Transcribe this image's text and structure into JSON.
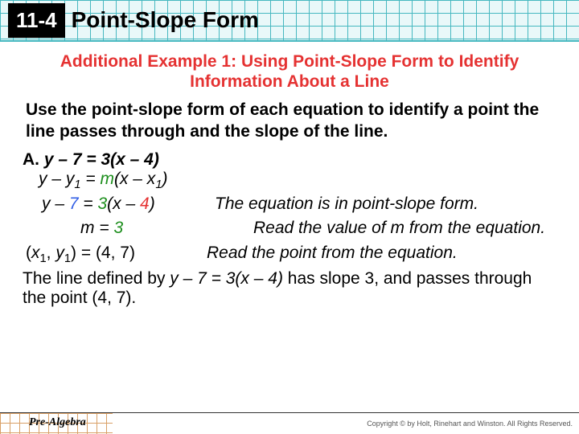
{
  "header": {
    "lesson_number": "11-4",
    "lesson_title": "Point-Slope Form"
  },
  "subhead": "Additional Example 1: Using Point-Slope Form to Identify Information About a Line",
  "prompt": "Use the point-slope form of each equation to identify a point the line passes through and the slope of the line.",
  "problem": {
    "label": "A.",
    "equation_plain": "y – 7 = 3(x – 4)"
  },
  "template": {
    "left": "y – y",
    "mid": " = ",
    "m": "m",
    "after_m": "(x – x",
    "close": ")"
  },
  "steps": [
    {
      "lhs_parts": {
        "prefix": "y – ",
        "y1": "7",
        "mid": " = ",
        "m": "3",
        "after_m": "(x – ",
        "x1": "4",
        "close": ")"
      },
      "expl": "The equation is in point-slope form."
    },
    {
      "lhs_m": {
        "prefix": "m = ",
        "m": "3"
      },
      "expl": "Read the value of m from the equation."
    },
    {
      "lhs_point": {
        "open": "(",
        "x1v": "x",
        "xsub": "1",
        "sep": ", ",
        "y1v": "y",
        "ysub": "1",
        "close": ") = (4, 7)"
      },
      "expl": "Read the point from the equation."
    }
  ],
  "conclusion": {
    "p1": "The line defined by ",
    "eq": "y – 7 = 3(x – 4)",
    "p2": " has slope 3, and passes through the point (4, 7)."
  },
  "footer": {
    "course": "Pre-Algebra",
    "copyright": "Copyright © by Holt, Rinehart and Winston. All Rights Reserved."
  }
}
